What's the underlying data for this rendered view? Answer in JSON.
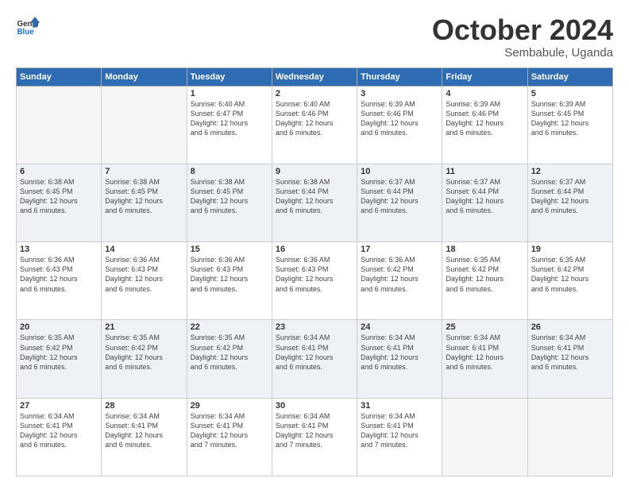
{
  "logo": {
    "line1": "General",
    "line2": "Blue"
  },
  "header": {
    "month": "October 2024",
    "location": "Sembabule, Uganda"
  },
  "weekdays": [
    "Sunday",
    "Monday",
    "Tuesday",
    "Wednesday",
    "Thursday",
    "Friday",
    "Saturday"
  ],
  "weeks": [
    [
      {
        "day": "",
        "info": ""
      },
      {
        "day": "",
        "info": ""
      },
      {
        "day": "1",
        "info": "Sunrise: 6:40 AM\nSunset: 6:47 PM\nDaylight: 12 hours\nand 6 minutes."
      },
      {
        "day": "2",
        "info": "Sunrise: 6:40 AM\nSunset: 6:46 PM\nDaylight: 12 hours\nand 6 minutes."
      },
      {
        "day": "3",
        "info": "Sunrise: 6:39 AM\nSunset: 6:46 PM\nDaylight: 12 hours\nand 6 minutes."
      },
      {
        "day": "4",
        "info": "Sunrise: 6:39 AM\nSunset: 6:46 PM\nDaylight: 12 hours\nand 6 minutes."
      },
      {
        "day": "5",
        "info": "Sunrise: 6:39 AM\nSunset: 6:45 PM\nDaylight: 12 hours\nand 6 minutes."
      }
    ],
    [
      {
        "day": "6",
        "info": "Sunrise: 6:38 AM\nSunset: 6:45 PM\nDaylight: 12 hours\nand 6 minutes."
      },
      {
        "day": "7",
        "info": "Sunrise: 6:38 AM\nSunset: 6:45 PM\nDaylight: 12 hours\nand 6 minutes."
      },
      {
        "day": "8",
        "info": "Sunrise: 6:38 AM\nSunset: 6:45 PM\nDaylight: 12 hours\nand 6 minutes."
      },
      {
        "day": "9",
        "info": "Sunrise: 6:38 AM\nSunset: 6:44 PM\nDaylight: 12 hours\nand 6 minutes."
      },
      {
        "day": "10",
        "info": "Sunrise: 6:37 AM\nSunset: 6:44 PM\nDaylight: 12 hours\nand 6 minutes."
      },
      {
        "day": "11",
        "info": "Sunrise: 6:37 AM\nSunset: 6:44 PM\nDaylight: 12 hours\nand 6 minutes."
      },
      {
        "day": "12",
        "info": "Sunrise: 6:37 AM\nSunset: 6:44 PM\nDaylight: 12 hours\nand 6 minutes."
      }
    ],
    [
      {
        "day": "13",
        "info": "Sunrise: 6:36 AM\nSunset: 6:43 PM\nDaylight: 12 hours\nand 6 minutes."
      },
      {
        "day": "14",
        "info": "Sunrise: 6:36 AM\nSunset: 6:43 PM\nDaylight: 12 hours\nand 6 minutes."
      },
      {
        "day": "15",
        "info": "Sunrise: 6:36 AM\nSunset: 6:43 PM\nDaylight: 12 hours\nand 6 minutes."
      },
      {
        "day": "16",
        "info": "Sunrise: 6:36 AM\nSunset: 6:43 PM\nDaylight: 12 hours\nand 6 minutes."
      },
      {
        "day": "17",
        "info": "Sunrise: 6:36 AM\nSunset: 6:42 PM\nDaylight: 12 hours\nand 6 minutes."
      },
      {
        "day": "18",
        "info": "Sunrise: 6:35 AM\nSunset: 6:42 PM\nDaylight: 12 hours\nand 6 minutes."
      },
      {
        "day": "19",
        "info": "Sunrise: 6:35 AM\nSunset: 6:42 PM\nDaylight: 12 hours\nand 6 minutes."
      }
    ],
    [
      {
        "day": "20",
        "info": "Sunrise: 6:35 AM\nSunset: 6:42 PM\nDaylight: 12 hours\nand 6 minutes."
      },
      {
        "day": "21",
        "info": "Sunrise: 6:35 AM\nSunset: 6:42 PM\nDaylight: 12 hours\nand 6 minutes."
      },
      {
        "day": "22",
        "info": "Sunrise: 6:35 AM\nSunset: 6:42 PM\nDaylight: 12 hours\nand 6 minutes."
      },
      {
        "day": "23",
        "info": "Sunrise: 6:34 AM\nSunset: 6:41 PM\nDaylight: 12 hours\nand 6 minutes."
      },
      {
        "day": "24",
        "info": "Sunrise: 6:34 AM\nSunset: 6:41 PM\nDaylight: 12 hours\nand 6 minutes."
      },
      {
        "day": "25",
        "info": "Sunrise: 6:34 AM\nSunset: 6:41 PM\nDaylight: 12 hours\nand 6 minutes."
      },
      {
        "day": "26",
        "info": "Sunrise: 6:34 AM\nSunset: 6:41 PM\nDaylight: 12 hours\nand 6 minutes."
      }
    ],
    [
      {
        "day": "27",
        "info": "Sunrise: 6:34 AM\nSunset: 6:41 PM\nDaylight: 12 hours\nand 6 minutes."
      },
      {
        "day": "28",
        "info": "Sunrise: 6:34 AM\nSunset: 6:41 PM\nDaylight: 12 hours\nand 6 minutes."
      },
      {
        "day": "29",
        "info": "Sunrise: 6:34 AM\nSunset: 6:41 PM\nDaylight: 12 hours\nand 7 minutes."
      },
      {
        "day": "30",
        "info": "Sunrise: 6:34 AM\nSunset: 6:41 PM\nDaylight: 12 hours\nand 7 minutes."
      },
      {
        "day": "31",
        "info": "Sunrise: 6:34 AM\nSunset: 6:41 PM\nDaylight: 12 hours\nand 7 minutes."
      },
      {
        "day": "",
        "info": ""
      },
      {
        "day": "",
        "info": ""
      }
    ]
  ]
}
